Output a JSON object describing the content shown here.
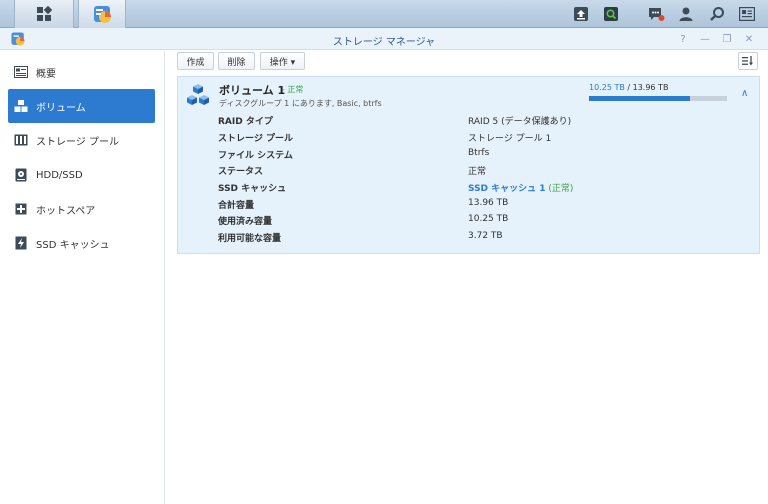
{
  "window": {
    "title": "ストレージ マネージャ",
    "help": "?",
    "minimize": "—",
    "maximize": "❐",
    "close": "✕"
  },
  "sidebar": {
    "items": [
      {
        "label": "概要",
        "icon": "overview-icon"
      },
      {
        "label": "ボリューム",
        "icon": "volume-icon",
        "active": true
      },
      {
        "label": "ストレージ プール",
        "icon": "storage-pool-icon"
      },
      {
        "label": "HDD/SSD",
        "icon": "hdd-icon"
      },
      {
        "label": "ホットスペア",
        "icon": "hot-spare-icon"
      },
      {
        "label": "SSD キャッシュ",
        "icon": "ssd-cache-icon"
      }
    ]
  },
  "toolbar": {
    "create_label": "作成",
    "delete_label": "削除",
    "action_label": "操作 ▾"
  },
  "volume": {
    "name": "ボリューム 1",
    "status_prefix": "- 正常",
    "subtitle": "ディスクグループ 1 にあります, Basic, btrfs",
    "used": "10.25 TB",
    "total": "13.96 TB",
    "usage_separator": " / ",
    "usage_fraction": 0.734,
    "details": [
      {
        "key": "RAID タイプ",
        "value": "RAID 5 (データ保護あり)"
      },
      {
        "key": "ストレージ プール",
        "value": "ストレージ プール 1"
      },
      {
        "key": "ファイル システム",
        "value": "Btrfs"
      },
      {
        "key": "ステータス",
        "value": "正常"
      },
      {
        "key": "SSD キャッシュ",
        "value_link": "SSD キャッシュ 1",
        "value_suffix": " (正常)"
      },
      {
        "key": "合計容量",
        "value": "13.96 TB"
      },
      {
        "key": "使用済み容量",
        "value": "10.25 TB"
      },
      {
        "key": "利用可能な容量",
        "value": "3.72 TB"
      }
    ]
  },
  "colors": {
    "accent": "#2d7bd0",
    "ok_green": "#3aa54a"
  }
}
